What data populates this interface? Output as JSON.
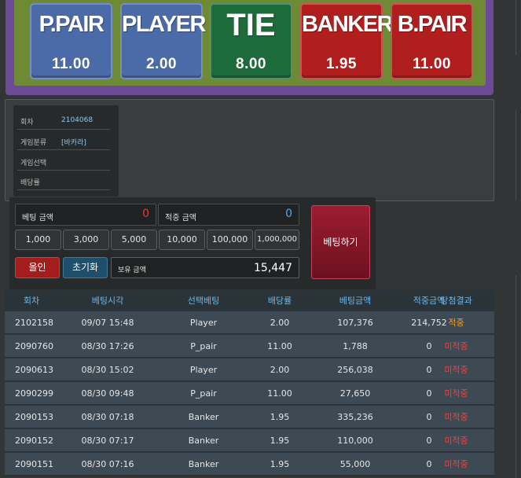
{
  "bet_options": [
    {
      "name": "P.PAIR",
      "odds": "11.00",
      "color": "#4a6aa8"
    },
    {
      "name": "PLAYER",
      "odds": "2.00",
      "color": "#4a6aa8"
    },
    {
      "name": "TIE",
      "odds": "8.00",
      "color": "#1d6a3b"
    },
    {
      "name": "BANKER",
      "odds": "1.95",
      "color": "#b01e1e"
    },
    {
      "name": "B.PAIR",
      "odds": "11.00",
      "color": "#b01e1e"
    }
  ],
  "info": {
    "round_label": "회차",
    "round_value": "2104068",
    "category_label": "게임분류",
    "category_value": "[바카라]",
    "selection_label": "게임선택",
    "selection_value": "",
    "odds_label": "배당률",
    "odds_value": ""
  },
  "control": {
    "bet_amount_label": "베팅 금액",
    "bet_amount_value": "0",
    "win_amount_label": "적중 금액",
    "win_amount_value": "0",
    "chips": [
      "1,000",
      "3,000",
      "5,000",
      "10,000",
      "100,000",
      "1,000,000"
    ],
    "allin_label": "올인",
    "reset_label": "초기화",
    "balance_label": "보유 금액",
    "balance_value": "15,447",
    "bet_button_label": "베팅하기",
    "bet_amount_color": "#e03c3c",
    "win_amount_color": "#5aa8e8"
  },
  "history": {
    "headers": [
      "회차",
      "베팅시각",
      "선택베팅",
      "배당률",
      "베팅금액",
      "적중금액",
      "당첨결과"
    ],
    "rows": [
      {
        "round": "2102158",
        "time": "09/07 15:48",
        "pick": "Player",
        "odds": "2.00",
        "bet": "107,376",
        "win": "214,752",
        "result": "적중",
        "status": "win"
      },
      {
        "round": "2090760",
        "time": "08/30 17:26",
        "pick": "P_pair",
        "odds": "11.00",
        "bet": "1,788",
        "win": "0",
        "result": "미적중",
        "status": "lose"
      },
      {
        "round": "2090613",
        "time": "08/30 15:02",
        "pick": "Player",
        "odds": "2.00",
        "bet": "256,038",
        "win": "0",
        "result": "미적중",
        "status": "lose"
      },
      {
        "round": "2090299",
        "time": "08/30 09:48",
        "pick": "P_pair",
        "odds": "11.00",
        "bet": "27,650",
        "win": "0",
        "result": "미적중",
        "status": "lose"
      },
      {
        "round": "2090153",
        "time": "08/30 07:18",
        "pick": "Banker",
        "odds": "1.95",
        "bet": "335,236",
        "win": "0",
        "result": "미적중",
        "status": "lose"
      },
      {
        "round": "2090152",
        "time": "08/30 07:17",
        "pick": "Banker",
        "odds": "1.95",
        "bet": "110,000",
        "win": "0",
        "result": "미적중",
        "status": "lose"
      },
      {
        "round": "2090151",
        "time": "08/30 07:16",
        "pick": "Banker",
        "odds": "1.95",
        "bet": "55,000",
        "win": "0",
        "result": "미적중",
        "status": "lose"
      }
    ]
  }
}
